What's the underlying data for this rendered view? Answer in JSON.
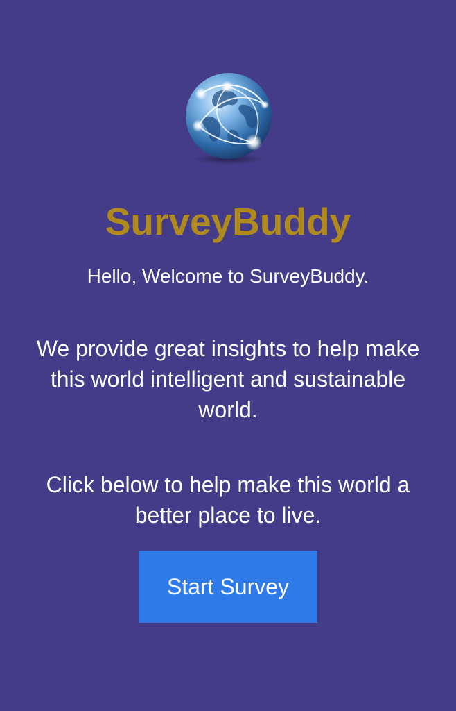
{
  "app": {
    "name": "SurveyBuddy",
    "logo_icon": "globe-network-icon"
  },
  "content": {
    "welcome": "Hello, Welcome to SurveyBuddy.",
    "insight_text": "We provide great insights to help make this world intelligent and sustainable world.",
    "cta_text": "Click below to help make this world a better place to live."
  },
  "actions": {
    "start_label": "Start Survey"
  },
  "colors": {
    "background": "#453c89",
    "brand": "#b08a1c",
    "button": "#2e7ae8",
    "text": "#ffffff"
  }
}
